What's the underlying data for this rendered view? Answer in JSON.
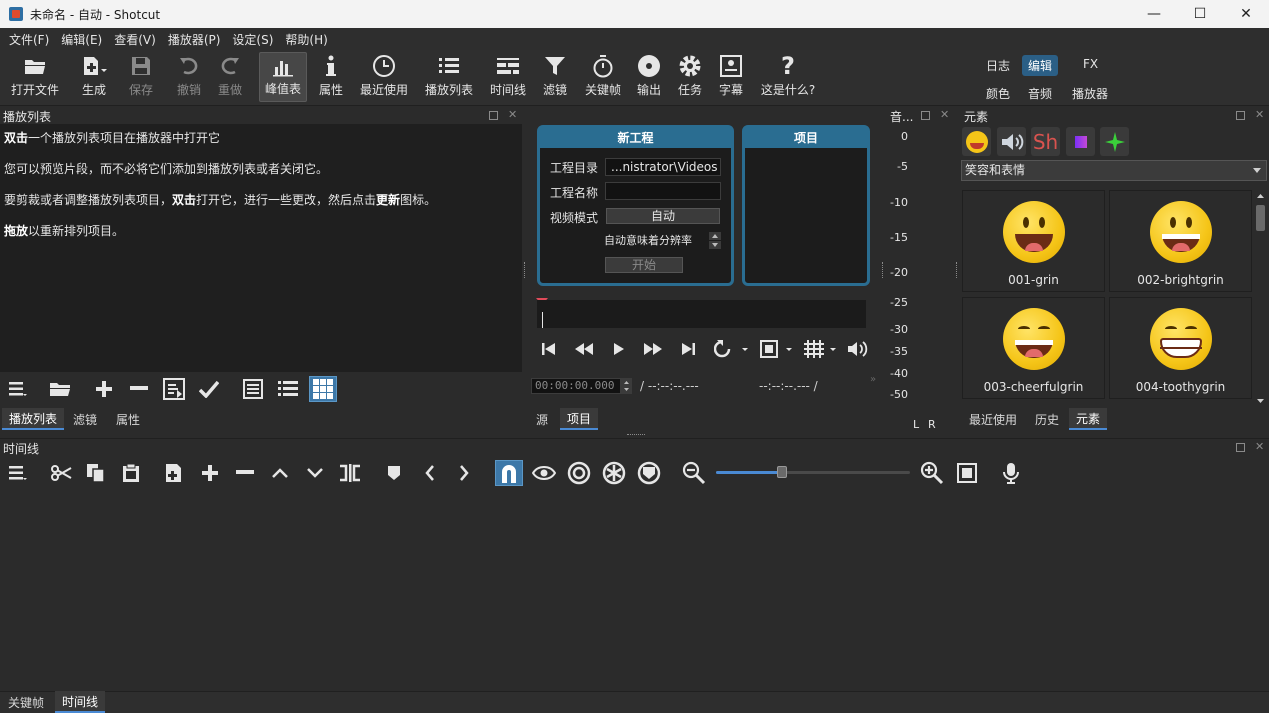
{
  "window": {
    "title": "未命名 - 自动 - Shotcut",
    "minimize": "—",
    "maximize": "☐",
    "close": "✕"
  },
  "menu": [
    "文件(F)",
    "编辑(E)",
    "查看(V)",
    "播放器(P)",
    "设定(S)",
    "帮助(H)"
  ],
  "toolbar": {
    "open": "打开文件",
    "generate": "生成",
    "save": "保存",
    "undo": "撤销",
    "redo": "重做",
    "peak": "峰值表",
    "properties": "属性",
    "recent": "最近使用",
    "playlist": "播放列表",
    "timeline": "时间线",
    "filters": "滤镜",
    "keyframes": "关键帧",
    "export": "输出",
    "jobs": "任务",
    "subtitles": "字幕",
    "whats_this": "这是什么?",
    "whats_this_glyph": "?"
  },
  "workspaces": {
    "log": "日志",
    "edit": "编辑",
    "fx": "FX",
    "color": "颜色",
    "audio": "音频",
    "player": "播放器"
  },
  "playlist": {
    "title": "播放列表",
    "line1_bold": "双击",
    "line1_rest": "一个播放列表项目在播放器中打开它",
    "line2": "您可以预览片段，而不必将它们添加到播放列表或者关闭它。",
    "line3_a": "要剪裁或者调整播放列表项目，",
    "line3_bold1": "双击",
    "line3_b": "打开它，进行一些更改，然后点击",
    "line3_bold2": "更新",
    "line3_c": "图标。",
    "line4_bold": "拖放",
    "line4_rest": "以重新排列项目。",
    "tabs": [
      "播放列表",
      "滤镜",
      "属性"
    ]
  },
  "new_project": {
    "title": "新工程",
    "dir_label": "工程目录",
    "dir_value": "...nistrator\\Videos",
    "name_label": "工程名称",
    "name_value": "",
    "mode_label": "视频模式",
    "mode_value": "自动",
    "auto_note": "自动意味着分辨率",
    "start": "开始"
  },
  "project": {
    "title": "项目"
  },
  "player": {
    "timecode": "00:00:00.000",
    "duration": "/ --:--:--.---",
    "in_out": "--:--:--.--- /",
    "tabs": [
      "源",
      "项目"
    ]
  },
  "meter": {
    "title": "音...",
    "labels": [
      "0",
      "-5",
      "-10",
      "-15",
      "-20",
      "-25",
      "-30",
      "-35",
      "-40",
      "-50"
    ],
    "left": "L",
    "right": "R"
  },
  "elements": {
    "title": "元素",
    "shotcut_mark": "Sh",
    "category": "笑容和表情",
    "items": [
      "001-grin",
      "002-brightgrin",
      "003-cheerfulgrin",
      "004-toothygrin"
    ],
    "tabs": [
      "最近使用",
      "历史",
      "元素"
    ]
  },
  "timeline": {
    "title": "时间线"
  },
  "bottom_tabs": [
    "关键帧",
    "时间线"
  ]
}
